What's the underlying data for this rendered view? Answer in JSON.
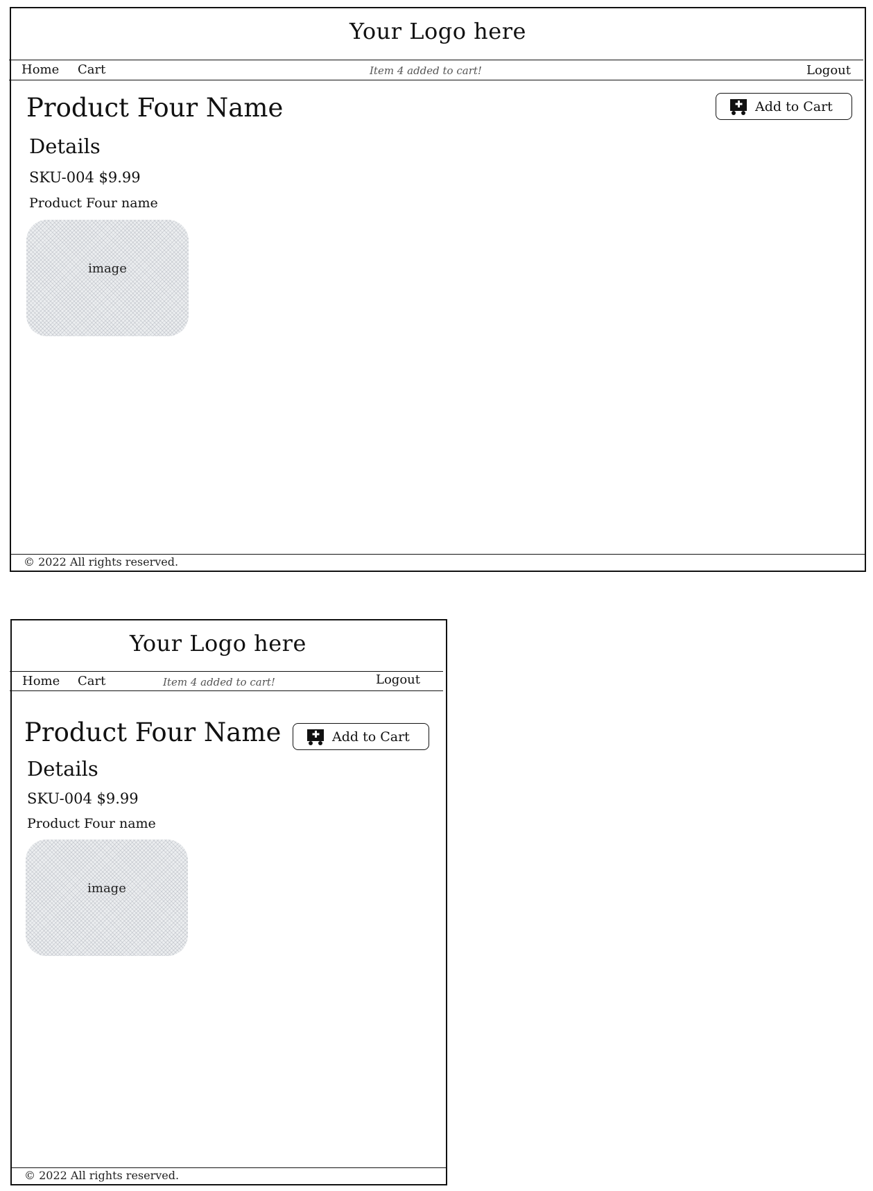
{
  "desktop": {
    "logo": "Your Logo here",
    "nav": {
      "home": "Home",
      "cart": "Cart",
      "notice": "Item 4 added to cart!",
      "logout": "Logout"
    },
    "product_title": "Product Four Name",
    "add_to_cart": "Add to Cart",
    "details_heading": "Details",
    "sku_price": "SKU-004 $9.99",
    "product_name": "Product Four name",
    "image_label": "image",
    "footer": "© 2022 All rights reserved."
  },
  "mobile": {
    "logo": "Your Logo here",
    "nav": {
      "home": "Home",
      "cart": "Cart",
      "notice": "Item 4 added to cart!",
      "logout": "Logout"
    },
    "product_title": "Product Four Name",
    "add_to_cart": "Add to Cart",
    "details_heading": "Details",
    "sku_price": "SKU-004 $9.99",
    "product_name": "Product Four name",
    "image_label": "image",
    "footer": "© 2022 All rights reserved."
  },
  "icons": {
    "cart": "add-to-cart-icon"
  }
}
